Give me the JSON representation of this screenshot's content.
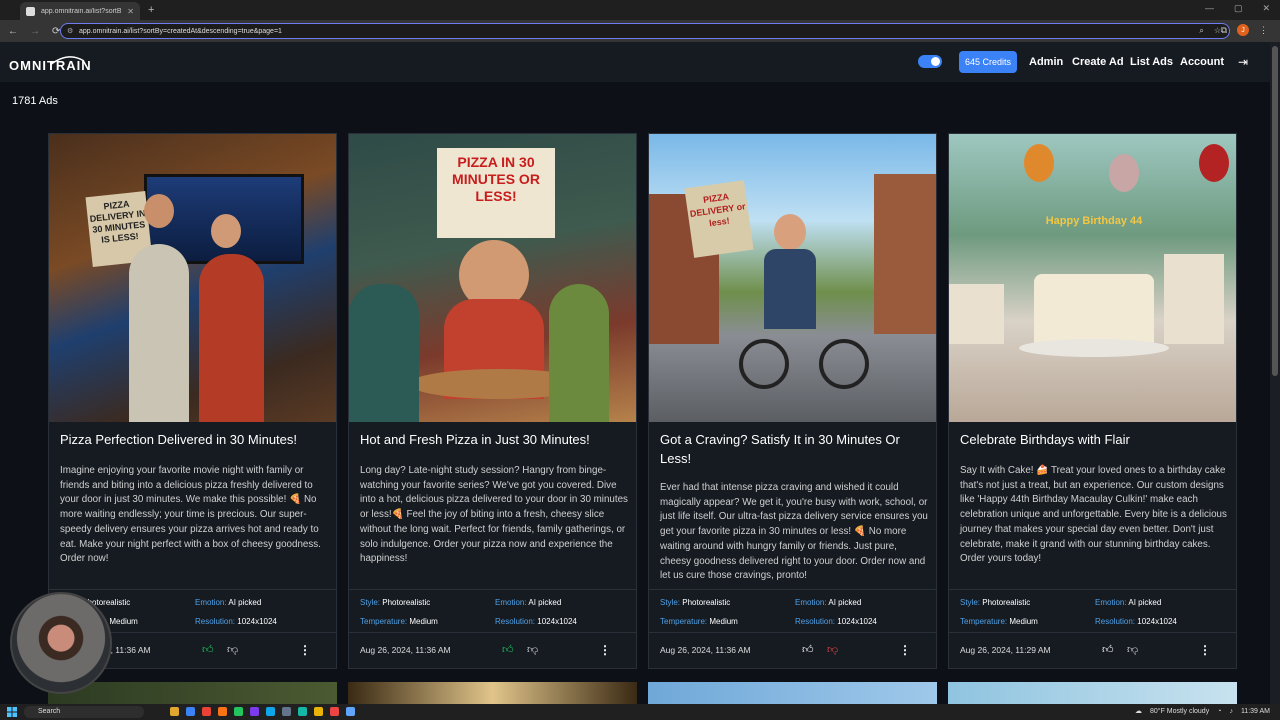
{
  "browser": {
    "tab_title": "app.omnitrain.ai/list?sortBy=cr...",
    "url": "app.omnitrain.ai/list?sortBy=createdAt&descending=true&page=1"
  },
  "header": {
    "logo": "OMNITRAIN",
    "credits": "645 Credits",
    "nav": [
      "Admin",
      "Create Ad",
      "List Ads",
      "Account"
    ]
  },
  "count_label": "1781 Ads",
  "labels": {
    "style": "Style:",
    "emotion": "Emotion:",
    "temperature": "Temperature:",
    "resolution": "Resolution:"
  },
  "cards": [
    {
      "title": "Pizza Perfection Delivered in 30 Minutes!",
      "description": "Imagine enjoying your favorite movie night with family or friends and biting into a delicious pizza freshly delivered to your door in just 30 minutes. We make this possible! 🍕 No more waiting endlessly; your time is precious. Our super-speedy delivery ensures your pizza arrives hot and ready to eat. Make your night perfect with a box of cheesy goodness. Order now!",
      "style": "Photorealistic",
      "emotion": "AI picked",
      "temperature": "Medium",
      "resolution": "1024x1024",
      "date": "Aug 26, 2024, 11:36 AM",
      "image_sign": "PIZZA DELIVERY IN 30 MINUTES IS LESS!"
    },
    {
      "title": "Hot and Fresh Pizza in Just 30 Minutes!",
      "description": "Long day? Late-night study session? Hangry from binge-watching your favorite series? We've got you covered. Dive into a hot, delicious pizza delivered to your door in 30 minutes or less!🍕 Feel the joy of biting into a fresh, cheesy slice without the long wait. Perfect for friends, family gatherings, or solo indulgence. Order your pizza now and experience the happiness!",
      "style": "Photorealistic",
      "emotion": "AI picked",
      "temperature": "Medium",
      "resolution": "1024x1024",
      "date": "Aug 26, 2024, 11:36 AM",
      "image_sign": "PIZZA IN 30 MINUTES OR LESS!"
    },
    {
      "title": "Got a Craving? Satisfy It in 30 Minutes Or Less!",
      "description": "Ever had that intense pizza craving and wished it could magically appear? We get it, you're busy with work, school, or just life itself. Our ultra-fast pizza delivery service ensures you get your favorite pizza in 30 minutes or less! 🍕 No more waiting around with hungry family or friends. Just pure, cheesy goodness delivered right to your door. Order now and let us cure those cravings, pronto!",
      "style": "Photorealistic",
      "emotion": "AI picked",
      "temperature": "Medium",
      "resolution": "1024x1024",
      "date": "Aug 26, 2024, 11:36 AM",
      "image_sign": "PIZZA DELIVERY or less!"
    },
    {
      "title": "Celebrate Birthdays with Flair",
      "description": "Say It with Cake! 🍰 Treat your loved ones to a birthday cake that's not just a treat, but an experience. Our custom designs like 'Happy 44th Birthday Macaulay Culkin!' make each celebration unique and unforgettable. Every bite is a delicious journey that makes your special day even better. Don't just celebrate, make it grand with our stunning birthday cakes. Order yours today!",
      "style": "Photorealistic",
      "emotion": "AI picked",
      "temperature": "Medium",
      "resolution": "1024x1024",
      "date": "Aug 26, 2024, 11:29 AM",
      "image_sign": "Happy Birthday 44"
    }
  ],
  "taskbar": {
    "search": "Search",
    "weather": "80°F  Mostly cloudy",
    "time": "11:39 AM"
  },
  "colors": {
    "accent": "#3b82f6",
    "bg": "#0d1117",
    "card": "#161b22",
    "meta_key": "#4ea1e8",
    "like": "#22c55e",
    "dislike_active": "#ef4444"
  }
}
